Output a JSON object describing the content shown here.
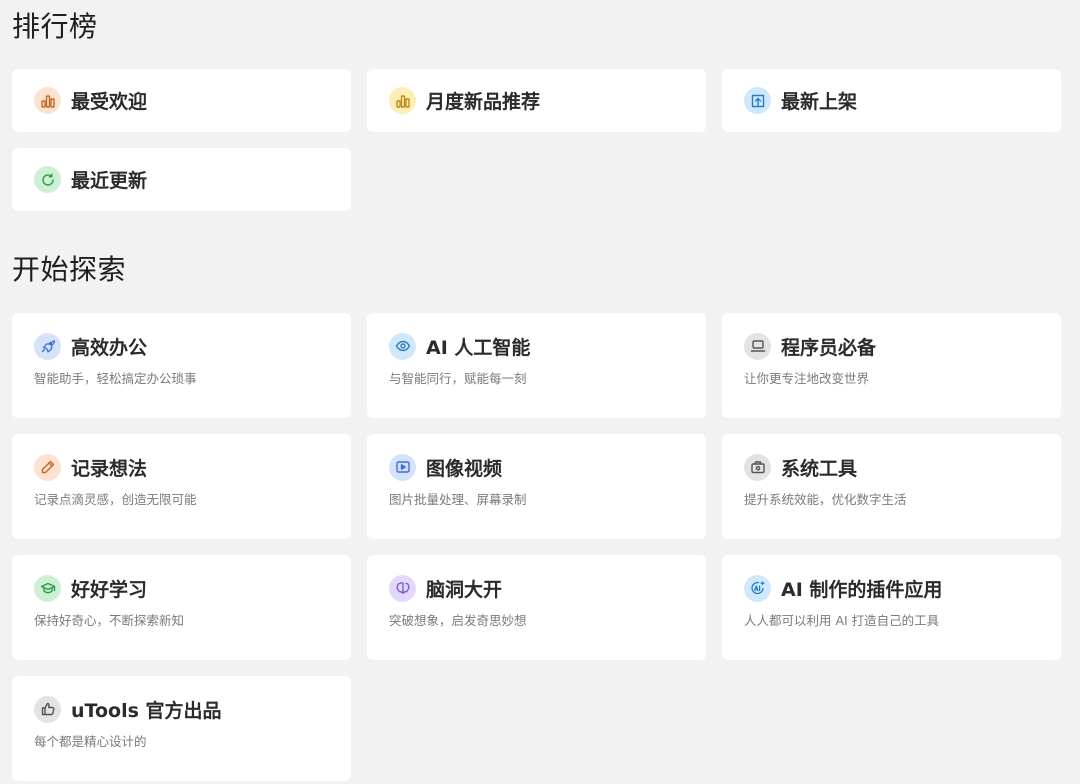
{
  "ranking": {
    "title": "排行榜",
    "items": [
      {
        "label": "最受欢迎",
        "icon": "bar-chart-icon",
        "icon_bg": "#fde3cf",
        "icon_color": "#c0672a"
      },
      {
        "label": "月度新品推荐",
        "icon": "bar-chart-icon",
        "icon_bg": "#fdeeb5",
        "icon_color": "#b98a12"
      },
      {
        "label": "最新上架",
        "icon": "upload-icon",
        "icon_bg": "#cfe8fb",
        "icon_color": "#2a7cc0"
      },
      {
        "label": "最近更新",
        "icon": "refresh-icon",
        "icon_bg": "#cdf0d4",
        "icon_color": "#2e9a47"
      }
    ]
  },
  "explore": {
    "title": "开始探索",
    "items": [
      {
        "title": "高效办公",
        "desc": "智能助手，轻松搞定办公琐事",
        "icon": "rocket-icon",
        "icon_bg": "#d5e2fb",
        "icon_color": "#3b6fd4"
      },
      {
        "title": "AI 人工智能",
        "desc": "与智能同行，赋能每一刻",
        "icon": "eye-icon",
        "icon_bg": "#cfe8fb",
        "icon_color": "#2a7cc0"
      },
      {
        "title": "程序员必备",
        "desc": "让你更专注地改变世界",
        "icon": "laptop-icon",
        "icon_bg": "#e3e3e3",
        "icon_color": "#555555"
      },
      {
        "title": "记录想法",
        "desc": "记录点滴灵感，创造无限可能",
        "icon": "pencil-icon",
        "icon_bg": "#fde3cf",
        "icon_color": "#c0672a"
      },
      {
        "title": "图像视频",
        "desc": "图片批量处理、屏幕录制",
        "icon": "video-icon",
        "icon_bg": "#d5e2fb",
        "icon_color": "#3b6fd4"
      },
      {
        "title": "系统工具",
        "desc": "提升系统效能，优化数字生活",
        "icon": "toolbox-icon",
        "icon_bg": "#e3e3e3",
        "icon_color": "#555555"
      },
      {
        "title": "好好学习",
        "desc": "保持好奇心，不断探索新知",
        "icon": "graduation-cap-icon",
        "icon_bg": "#cdf0d4",
        "icon_color": "#2e9a47"
      },
      {
        "title": "脑洞大开",
        "desc": "突破想象，启发奇思妙想",
        "icon": "brain-icon",
        "icon_bg": "#e2d8fb",
        "icon_color": "#7a52d0"
      },
      {
        "title": "AI 制作的插件应用",
        "desc": "人人都可以利用 AI 打造自己的工具",
        "icon": "ai-spark-icon",
        "icon_bg": "#cfe8fb",
        "icon_color": "#2a7cc0"
      },
      {
        "title": "uTools 官方出品",
        "desc": "每个都是精心设计的",
        "icon": "thumbs-up-icon",
        "icon_bg": "#e3e3e3",
        "icon_color": "#555555"
      }
    ]
  }
}
